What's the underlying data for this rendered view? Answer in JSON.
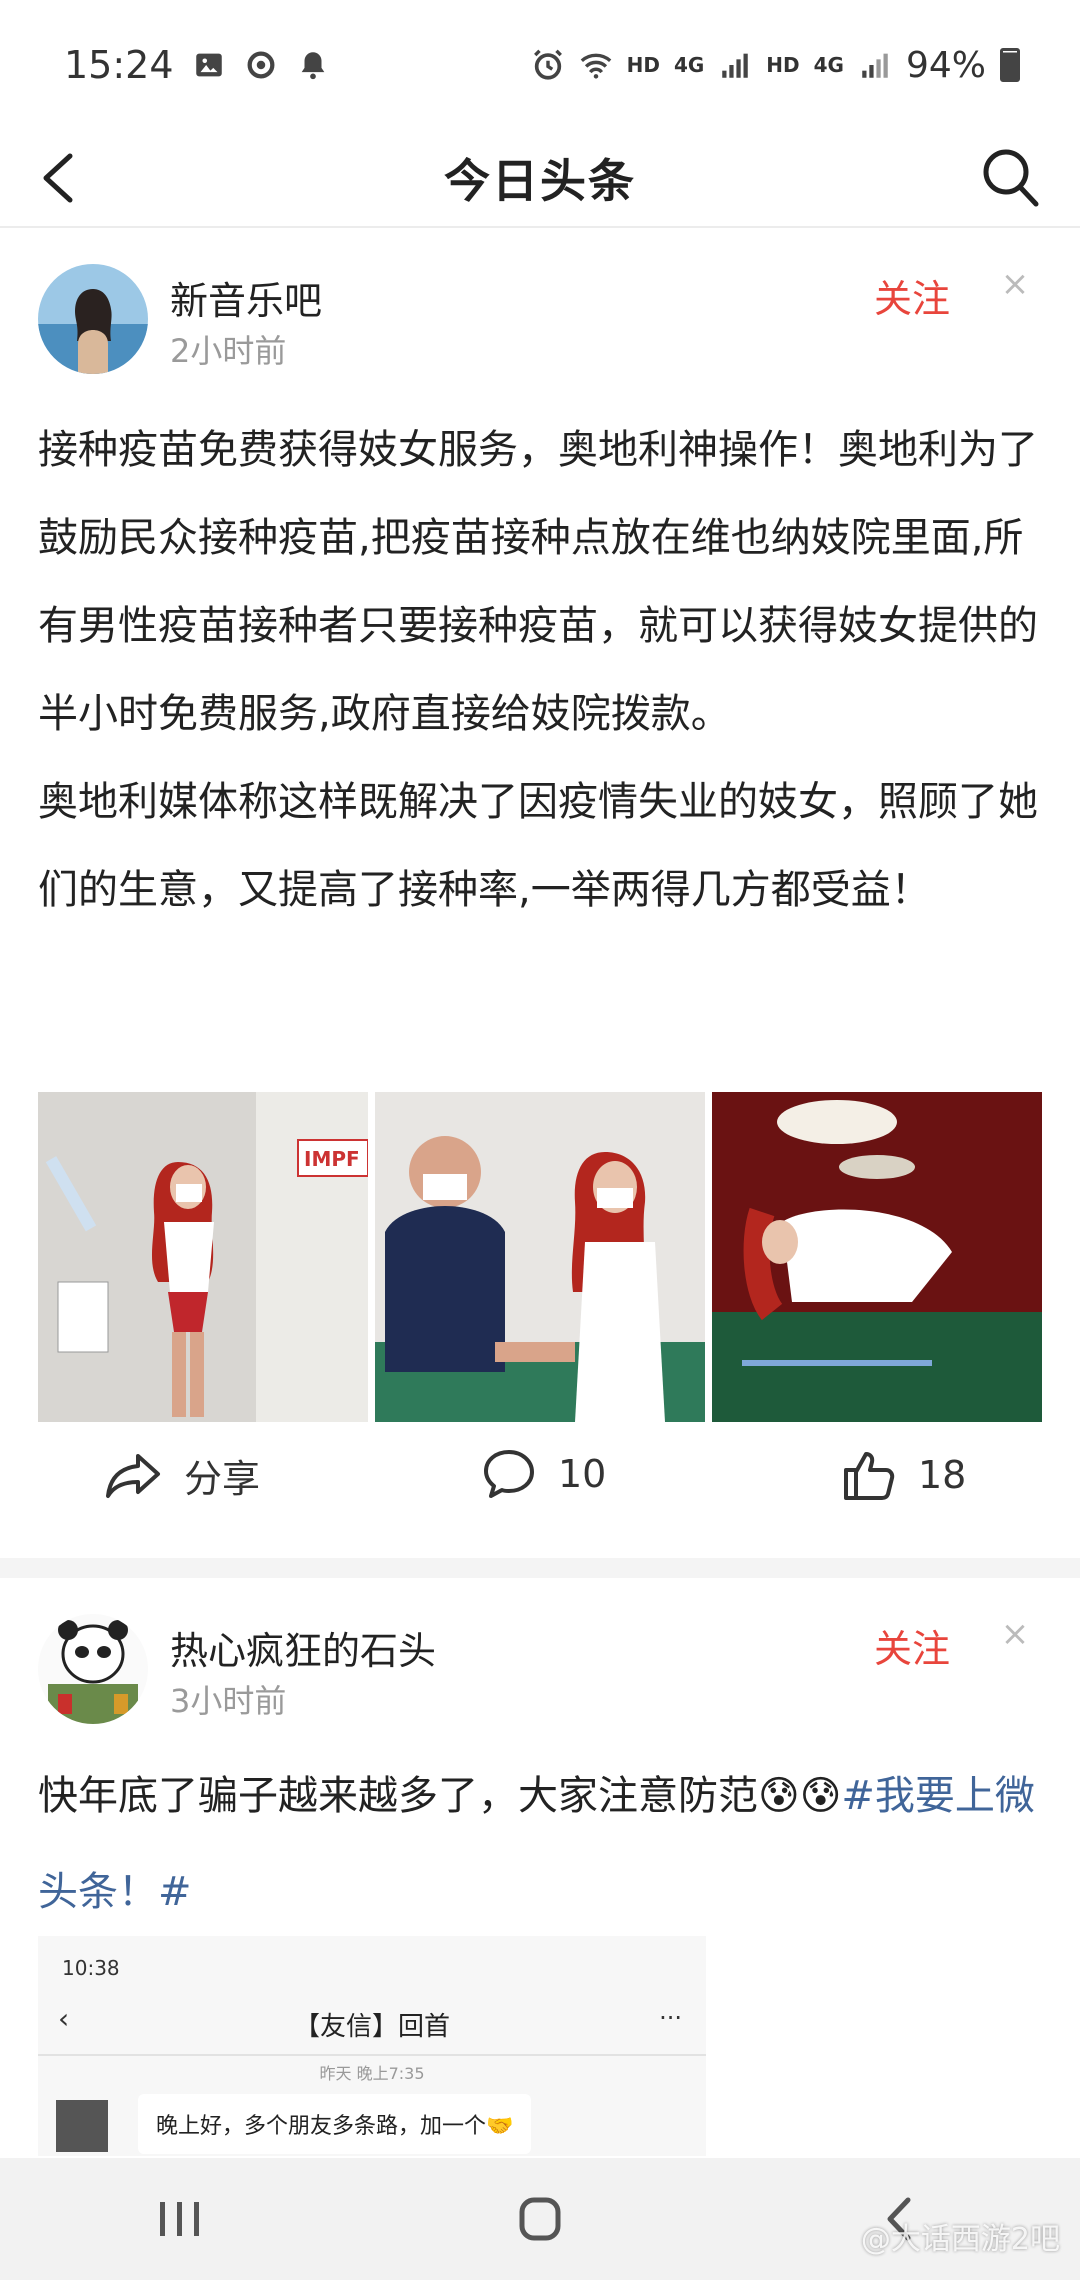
{
  "status": {
    "time": "15:24",
    "battery": "94%",
    "hd1": "HD",
    "net1": "4G",
    "hd2": "HD",
    "net2": "4G"
  },
  "header": {
    "title": "今日头条"
  },
  "posts": [
    {
      "author": "新音乐吧",
      "time": "2小时前",
      "follow": "关注",
      "dismiss": "×",
      "paragraphs": [
        "接种疫苗免费获得妓女服务，奥地利神操作！奥地利为了鼓励民众接种疫苗,把疫苗接种点放在维也纳妓院里面,所有男性疫苗接种者只要接种疫苗，就可以获得妓女提供的半小时免费服务,政府直接给妓院拨款。",
        "奥地利媒体称这样既解决了因疫情失业的妓女，照顾了她们的生意，又提高了接种率,一举两得几方都受益！"
      ],
      "image_text": "IMPF",
      "actions": {
        "share": "分享",
        "comments": "10",
        "likes": "18"
      }
    },
    {
      "author": "热心疯狂的石头",
      "time": "3小时前",
      "follow": "关注",
      "dismiss": "×",
      "text": "快年底了骗子越来越多了，大家注意防范😰😰",
      "hashtag": "#我要上微头条！#",
      "embedded_screenshot": {
        "time": "10:38",
        "title": "【友信】回首",
        "more": "···",
        "timestamp": "昨天 晚上7:35",
        "message": "晚上好，多个朋友多条路，加一个🤝"
      }
    }
  ],
  "watermark": "@大话西游2吧"
}
